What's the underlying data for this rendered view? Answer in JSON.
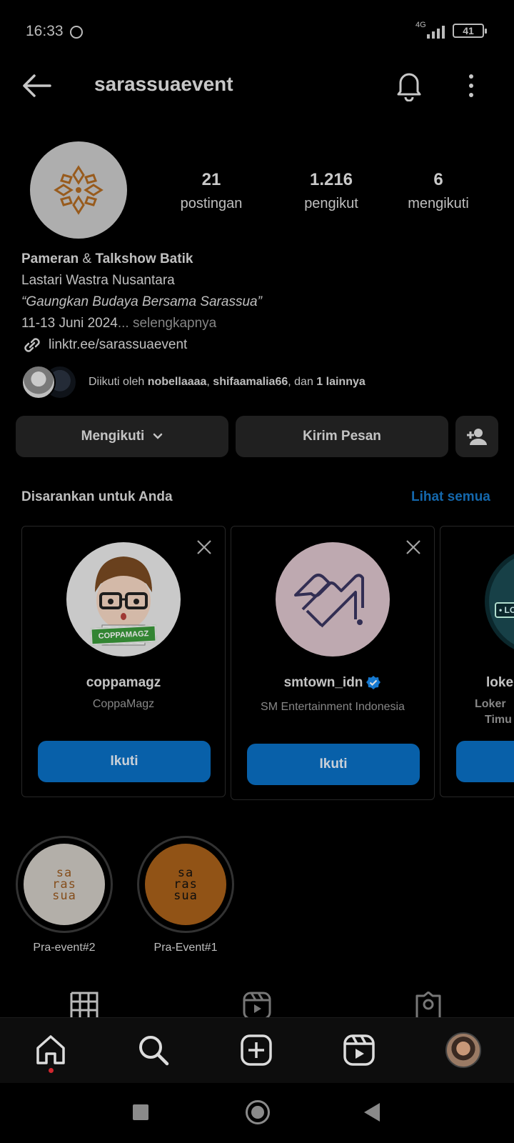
{
  "status_bar": {
    "time": "16:33",
    "network": "4G",
    "battery": "41"
  },
  "header": {
    "username": "sarassuaevent"
  },
  "profile": {
    "stats": [
      {
        "value": "21",
        "label": "postingan"
      },
      {
        "value": "1.216",
        "label": "pengikut"
      },
      {
        "value": "6",
        "label": "mengikuti"
      }
    ],
    "bio": {
      "line1_part1": "Pameran",
      "line1_part2": " & ",
      "line1_part3": "Talkshow Batik",
      "line2": "Lastari Wastra Nusantara",
      "line3": "“Gaungkan Budaya Bersama Sarassua”",
      "line4": "11-13 Juni 2024",
      "more": "... selengkapnya",
      "link": "linktr.ee/sarassuaevent"
    },
    "followed_by": {
      "prefix": "Diikuti oleh ",
      "user1": "nobellaaaa",
      "sep": ", ",
      "user2": "shifaamalia66",
      "mid": ", dan ",
      "others": "1 lainnya"
    }
  },
  "actions": {
    "following": "Mengikuti",
    "message": "Kirim Pesan"
  },
  "suggestions": {
    "title": "Disarankan untuk Anda",
    "see_all": "Lihat semua",
    "cards": [
      {
        "username": "coppamagz",
        "subtitle": "CoppaMagz",
        "button": "Ikuti",
        "badge": "COPPAMAGZ"
      },
      {
        "username": "smtown_idn",
        "subtitle": "SM Entertainment Indonesia",
        "button": "Ikuti",
        "verified": true
      },
      {
        "username": "loke",
        "subtitle_line1": "Loker",
        "subtitle_line2": "Timu",
        "badge": "• LO"
      }
    ]
  },
  "highlights": [
    {
      "label": "Pra-event#2",
      "logo": [
        "sa",
        "ras",
        "sua"
      ],
      "bg": "#cfcac4",
      "fg": "#9a5a20"
    },
    {
      "label": "Pra-Event#1",
      "logo": [
        "sa",
        "ras",
        "sua"
      ],
      "bg": "#a8601a",
      "fg": "#111111"
    }
  ],
  "colors": {
    "accent": "#1878c8",
    "button_blue": "#0a6fc4",
    "surface": "#262626"
  }
}
